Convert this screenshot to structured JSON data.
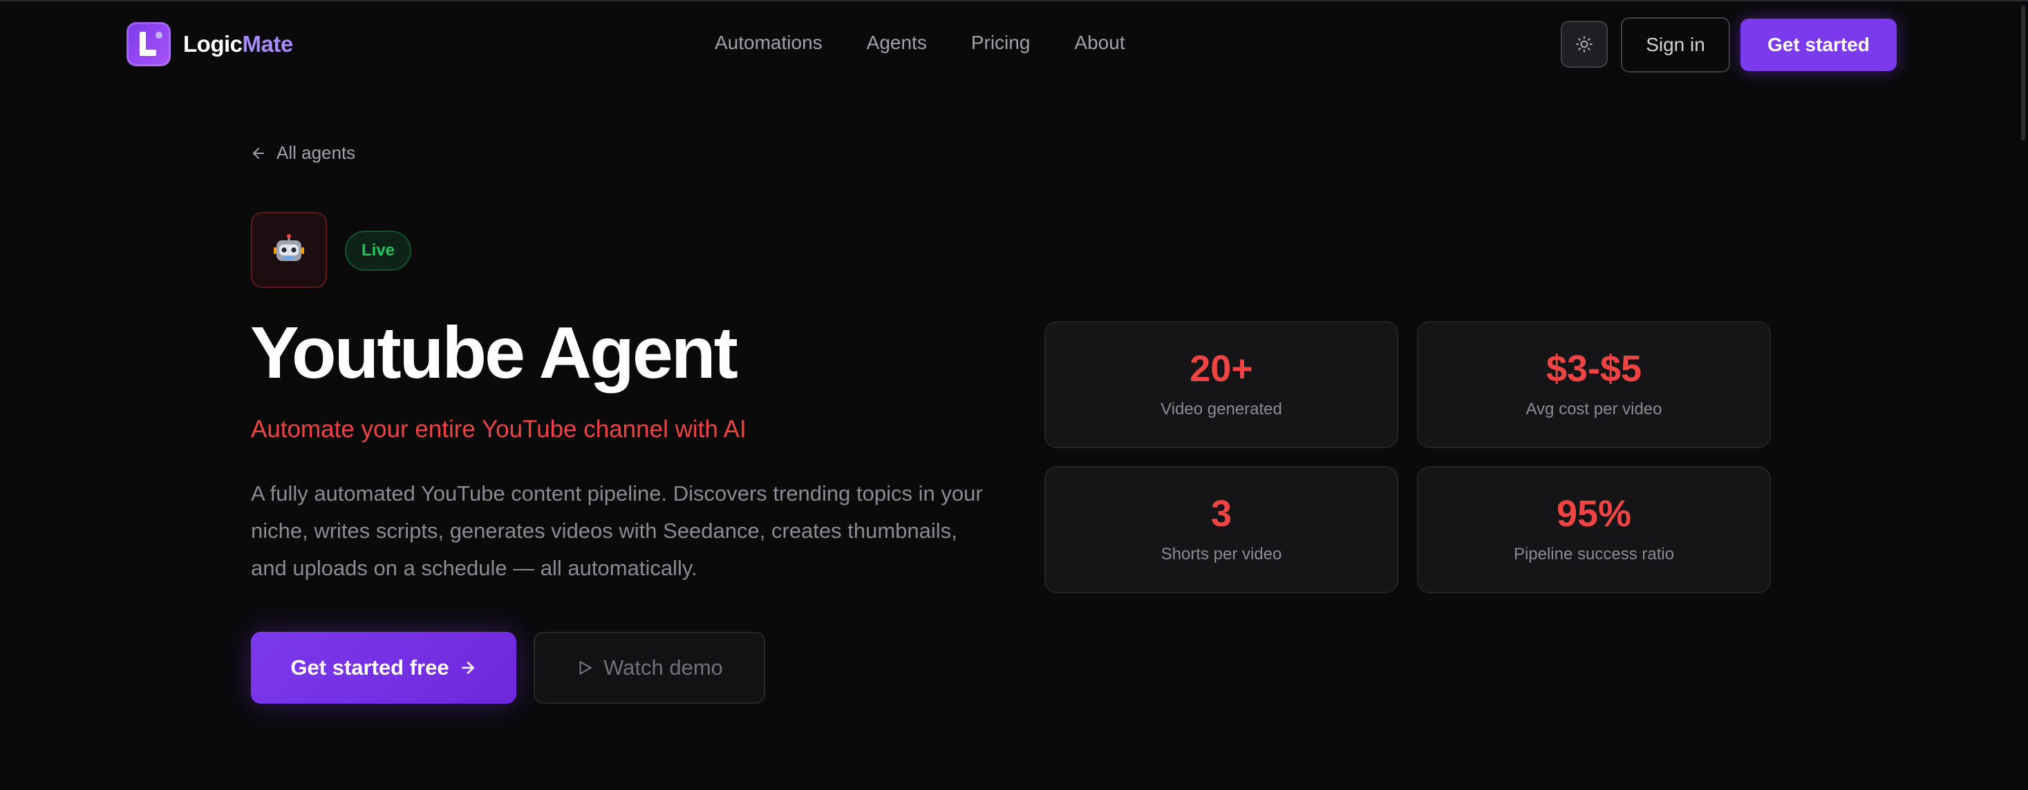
{
  "brand": {
    "name_part1": "Logic",
    "name_part2": "Mate"
  },
  "nav": {
    "items": [
      "Automations",
      "Agents",
      "Pricing",
      "About"
    ]
  },
  "header": {
    "sign_in": "Sign in",
    "get_started": "Get started"
  },
  "back_link": "All agents",
  "agent": {
    "icon": "🤖",
    "status": "Live",
    "title": "Youtube Agent",
    "subtitle": "Automate your entire YouTube channel with AI",
    "description": "A fully automated YouTube content pipeline. Discovers trending topics in your niche, writes scripts, generates videos with Seedance, creates thumbnails, and uploads on a schedule — all automatically."
  },
  "cta": {
    "primary": "Get started free",
    "secondary": "Watch demo"
  },
  "stats": [
    {
      "value": "20+",
      "label": "Video generated"
    },
    {
      "value": "$3-$5",
      "label": "Avg cost per video"
    },
    {
      "value": "3",
      "label": "Shorts per video"
    },
    {
      "value": "95%",
      "label": "Pipeline success ratio"
    }
  ],
  "colors": {
    "accent": "#7c3aed",
    "highlight": "#ef4444",
    "live": "#22c55e",
    "background": "#0a0a0b"
  },
  "icons": {
    "theme_toggle": "sun-icon",
    "back": "arrow-left-icon",
    "primary_cta": "arrow-right-icon",
    "secondary_cta": "play-icon"
  }
}
